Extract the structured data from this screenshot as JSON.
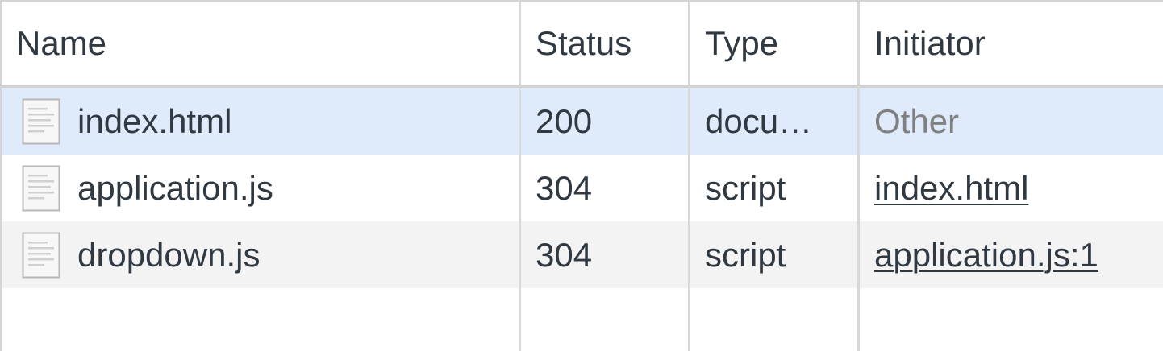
{
  "columns": {
    "name": "Name",
    "status": "Status",
    "type": "Type",
    "initiator": "Initiator"
  },
  "requests": [
    {
      "name": "index.html",
      "status": "200",
      "type": "docu…",
      "initiator": "Other",
      "selected": true,
      "icon": "document-icon"
    },
    {
      "name": "application.js",
      "status": "304",
      "type": "script",
      "initiator": "index.html",
      "selected": false,
      "icon": "document-icon"
    },
    {
      "name": "dropdown.js",
      "status": "304",
      "type": "script",
      "initiator": "application.js:1",
      "selected": false,
      "icon": "document-icon"
    }
  ],
  "colors": {
    "selected_row": "#dfebfb",
    "alt_row": "#f3f3f3",
    "grid_line": "#d8d8d8",
    "text": "#303942",
    "muted_text": "#808080"
  }
}
